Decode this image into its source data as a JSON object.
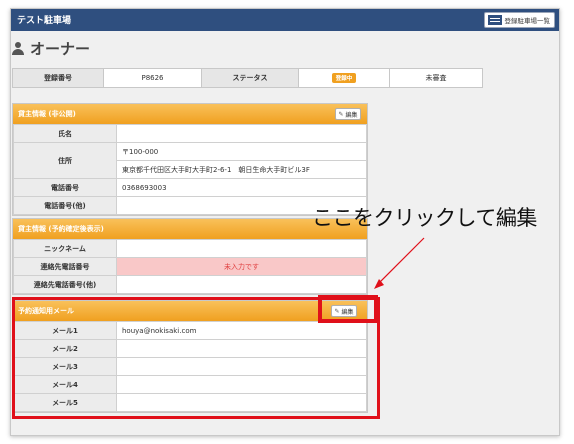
{
  "app": {
    "title": "テスト駐車場",
    "list_button_label": "登録駐車場一覧"
  },
  "page": {
    "title": "オーナー",
    "icon": "user-icon"
  },
  "summary": {
    "reg_no_label": "登録番号",
    "reg_no_value": "P8626",
    "status_label": "ステータス",
    "status_badge": "登録中",
    "review_status": "未審査"
  },
  "owner_info": {
    "title": "貸主情報 (非公開)",
    "edit_label": "編集",
    "rows": [
      {
        "label": "氏名",
        "value": ""
      },
      {
        "label": "住所",
        "postal": "〒100-000",
        "address": "東京都千代田区大手町大手町2-6-1　朝日生命大手町ビル3F"
      },
      {
        "label": "電話番号",
        "value": "0368693003"
      },
      {
        "label": "電話番号(他)",
        "value": ""
      }
    ]
  },
  "public_info": {
    "title": "貸主情報 (予約確定後表示)",
    "rows": [
      {
        "label": "ニックネーム",
        "value": ""
      },
      {
        "label": "連絡先電話番号",
        "value": "未入力です"
      },
      {
        "label": "連絡先電話番号(他)",
        "value": ""
      }
    ]
  },
  "mail_info": {
    "title": "予約通知用メール",
    "edit_label": "編集",
    "rows": [
      {
        "label": "メール1",
        "value": "houya@nokisaki.com"
      },
      {
        "label": "メール2",
        "value": ""
      },
      {
        "label": "メール3",
        "value": ""
      },
      {
        "label": "メール4",
        "value": ""
      },
      {
        "label": "メール5",
        "value": ""
      }
    ]
  },
  "annotation": {
    "text": "ここをクリックして編集",
    "color": "#e0101a"
  },
  "colors": {
    "header": "#2f4f7f",
    "section_header": "#f0a020",
    "highlight": "#e0101a"
  }
}
